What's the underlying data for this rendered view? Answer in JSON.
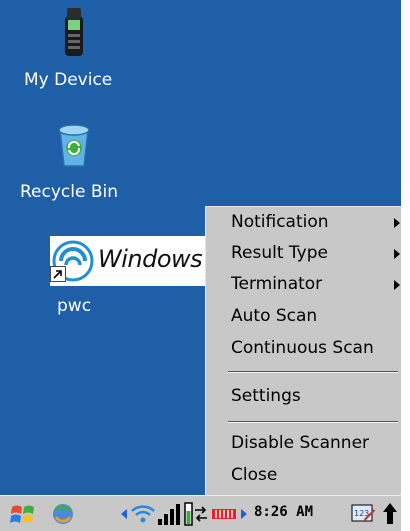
{
  "desktop": {
    "icons": [
      {
        "label": "My Device",
        "icon": "phone-icon"
      },
      {
        "label": "Recycle Bin",
        "icon": "recycle-bin-icon"
      },
      {
        "label": "pwc",
        "icon": "windows-shortcut-icon",
        "banner_text": "Windows E"
      }
    ]
  },
  "context_menu": {
    "items": [
      {
        "label": "Notification",
        "has_submenu": true
      },
      {
        "label": "Result Type",
        "has_submenu": true
      },
      {
        "label": "Terminator",
        "has_submenu": true
      },
      {
        "label": "Auto Scan",
        "has_submenu": false
      },
      {
        "label": "Continuous Scan",
        "has_submenu": false
      },
      {
        "label": "Settings",
        "has_submenu": false
      },
      {
        "label": "Disable Scanner",
        "has_submenu": false
      },
      {
        "label": "Close",
        "has_submenu": false
      }
    ]
  },
  "taskbar": {
    "time": "8:26 AM",
    "icons": [
      "start-icon",
      "sync-icon",
      "left-arrow-icon",
      "wifi-icon",
      "signal-icon",
      "battery-icon",
      "connection-icon",
      "scanner-icon",
      "right-arrow-icon",
      "keyboard-icon",
      "up-arrow-icon"
    ]
  },
  "colors": {
    "desktop_background": "#1f5fa8",
    "menu_background": "#c8c8c8",
    "taskbar_background": "#c8c8c8"
  }
}
